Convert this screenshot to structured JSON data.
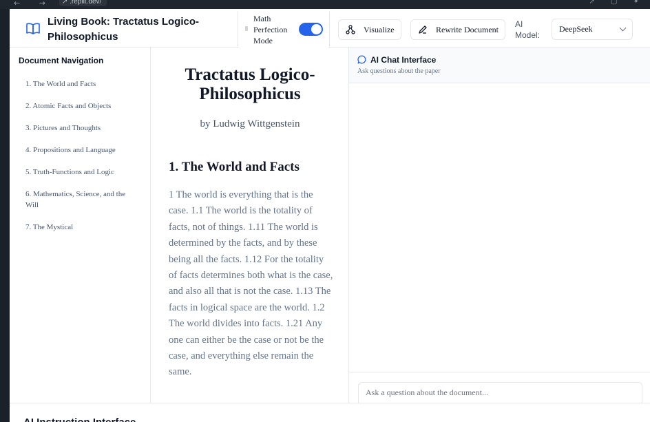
{
  "browser": {
    "nav_icons": "← → ↻",
    "url": "↗ .replit.dev/",
    "right_icons": "↗ ▢ ✦"
  },
  "header": {
    "title": "Living Book: Tractatus Logico-Philosophicus",
    "math_mode_label": "Math Perfection Mode",
    "math_mode_on": true,
    "visualize_label": "Visualize",
    "rewrite_label": "Rewrite Document",
    "ai_model_label": "AI Model:",
    "ai_model_value": "DeepSeek"
  },
  "sidebar": {
    "title": "Document Navigation",
    "items": [
      {
        "label": "1. The World and Facts"
      },
      {
        "label": "2. Atomic Facts and Objects"
      },
      {
        "label": "3. Pictures and Thoughts"
      },
      {
        "label": "4. Propositions and Language"
      },
      {
        "label": "5. Truth-Functions and Logic"
      },
      {
        "label": "6. Mathematics, Science, and the Will"
      },
      {
        "label": "7. The Mystical"
      }
    ]
  },
  "document": {
    "title": "Tractatus Logico-Philosophicus",
    "author": "by Ludwig Wittgenstein",
    "section_title": "1. The World and Facts",
    "body": "1 The world is everything that is the case. 1.1 The world is the totality of facts, not of things. 1.11 The world is determined by the facts, and by these being all the facts. 1.12 For the totality of facts determines both what is the case, and also all that is not the case. 1.13 The facts in logical space are the world. 1.2 The world divides into facts. 1.21 Any one can either be the case or not be the case, and everything else remain the same."
  },
  "chat": {
    "title": "AI Chat Interface",
    "subtitle": "Ask questions about the paper",
    "input_placeholder": "Ask a question about the document..."
  },
  "bottom": {
    "title": "AI Instruction Interface"
  },
  "colors": {
    "accent": "#2563eb",
    "text_dark": "#111827",
    "text_muted": "#64748b",
    "border": "#e5e7eb"
  },
  "icons": {
    "book": "book-open-icon",
    "visualize": "share-nodes-icon",
    "rewrite": "pencil-icon",
    "chat": "message-circle-icon",
    "dropdown": "chevron-down-icon"
  }
}
